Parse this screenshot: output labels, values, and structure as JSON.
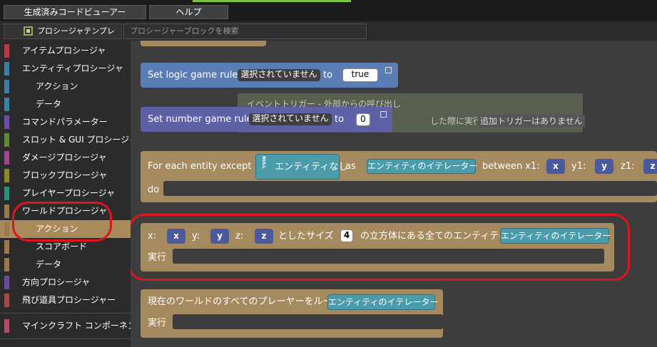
{
  "toolbar": {
    "code_viewer_label": "生成済みコードビューアー",
    "help_label": "ヘルプ"
  },
  "tabs": {
    "templates_label": "プロシージャテンプレート",
    "search_placeholder": "プロシージャーブロックを検索"
  },
  "sidebar": {
    "items": [
      {
        "label": "アイテムプロシージャ",
        "color": "#b23b4b"
      },
      {
        "label": "エンティティプロシージャ",
        "color": "#3f7f9f"
      },
      {
        "label": "アクション",
        "color": "#3f7f9f"
      },
      {
        "label": "データ",
        "color": "#3f7f9f"
      },
      {
        "label": "コマンドパラメーター",
        "color": "#6b4fa0"
      },
      {
        "label": "スロット & GUI プロシージャ",
        "color": "#5a8a3a"
      },
      {
        "label": "ダメージプロシージャ",
        "color": "#9a4a8a"
      },
      {
        "label": "ブロックプロシージャ",
        "color": "#8a8a2a"
      },
      {
        "label": "プレイヤープロシージャ",
        "color": "#2f8a7a"
      },
      {
        "label": "ワールドプロシージャ",
        "color": "#9a7a4a"
      },
      {
        "label": "アクション",
        "color": "#9a7a4a"
      },
      {
        "label": "スコアボード",
        "color": "#9a7a4a"
      },
      {
        "label": "データ",
        "color": "#9a7a4a"
      },
      {
        "label": "方向プロシージャ",
        "color": "#6a4a9a"
      },
      {
        "label": "飛び道具プロシージャー",
        "color": "#a04a4a"
      },
      {
        "label": "マインクラフト コンポーネント",
        "color": "#b0506a"
      }
    ]
  },
  "workspace": {
    "logic_rule": {
      "label": "Set logic game rule",
      "selector": "選択されていません",
      "to_label": "to",
      "value": "true"
    },
    "number_rule": {
      "label": "Set number game rule",
      "selector": "選択されていません",
      "to_label": "to",
      "value": "0"
    },
    "ghost": {
      "line1": "イベントトリガー - 外部からの呼び出し",
      "line2": "した際に実行される",
      "line3": "追加トリガーはありません"
    },
    "for_each": {
      "label": "For each entity except",
      "null_label": "NULL",
      "no_entity": "エンティティなし",
      "as_label": "as",
      "iterator": "エンティティのイテレーター",
      "between_label": "between x1:",
      "x_value": "x",
      "y1_label": "y1:",
      "y_value": "y",
      "z1_label": "z1:",
      "z_value": "z",
      "do_label": "do"
    },
    "cube": {
      "x_label": "x:",
      "x_value": "x",
      "y_label": "y:",
      "y_value": "y",
      "z_label": "z:",
      "z_value": "z",
      "size_label": "としたサイズ",
      "size_value": "4",
      "suffix": "の立方体にある全てのエンティティ",
      "iterator": "エンティティのイテレーター",
      "do_label": "実行"
    },
    "players_loop": {
      "label": "現在のワールドのすべてのプレーヤーをループ",
      "iterator": "エンティティのイテレーター",
      "do_label": "実行"
    }
  }
}
